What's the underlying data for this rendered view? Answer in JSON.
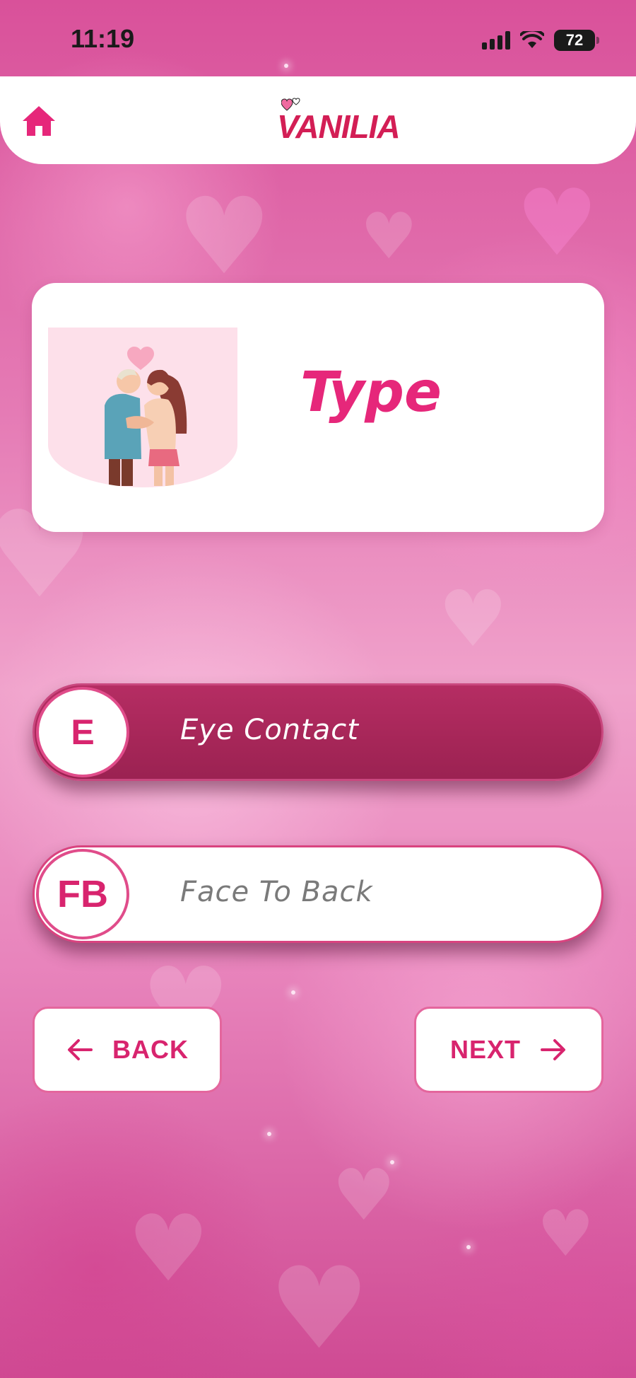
{
  "status_bar": {
    "time": "11:19",
    "battery": "72",
    "icons": [
      "signal-icon",
      "wifi-icon",
      "battery-icon"
    ]
  },
  "header": {
    "logo_text": "VANILIA",
    "home_icon": "home-icon",
    "accent_color": "#e6277a"
  },
  "card": {
    "title": "Type",
    "image": "couple-illustration"
  },
  "options": [
    {
      "badge": "E",
      "label": "Eye Contact",
      "selected": true
    },
    {
      "badge": "FB",
      "label": "Face To Back",
      "selected": false
    }
  ],
  "navigation": {
    "back_label": "BACK",
    "next_label": "NEXT",
    "back_icon": "arrow-left-icon",
    "next_icon": "arrow-right-icon"
  },
  "colors": {
    "primary": "#d8246e",
    "selected_option": "#a62658",
    "background": "#e57bb5"
  }
}
